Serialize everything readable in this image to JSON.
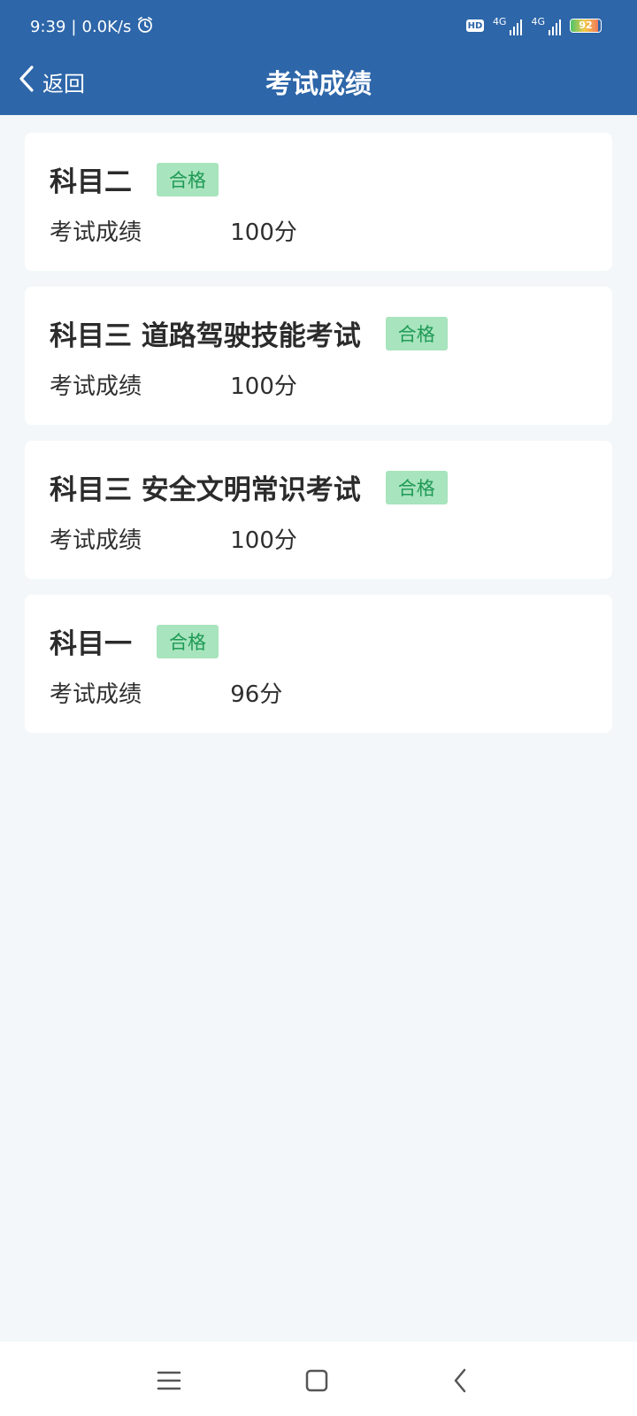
{
  "status_bar": {
    "time": "9:39",
    "speed": "0.0K/s",
    "hd": "HD",
    "network1": "4G",
    "network2": "4G",
    "battery": "92",
    "battery_fraction": 0.92
  },
  "header": {
    "back_label": "返回",
    "title": "考试成绩"
  },
  "exams": [
    {
      "subject": "科目二",
      "status": "合格",
      "score_label": "考试成绩",
      "score": "100分"
    },
    {
      "subject": "科目三 道路驾驶技能考试",
      "status": "合格",
      "score_label": "考试成绩",
      "score": "100分"
    },
    {
      "subject": "科目三 安全文明常识考试",
      "status": "合格",
      "score_label": "考试成绩",
      "score": "100分"
    },
    {
      "subject": "科目一",
      "status": "合格",
      "score_label": "考试成绩",
      "score": "96分"
    }
  ],
  "colors": {
    "header_bg": "#2d66a9",
    "page_bg": "#f3f7f9",
    "badge_bg": "#a8e4bd",
    "badge_text": "#1f9a55"
  },
  "icons": {
    "status_alarm": "alarm-clock-icon",
    "back": "chevron-left-icon",
    "nav_menu": "menu-icon",
    "nav_home": "home-square-icon",
    "nav_back": "back-triangle-icon"
  }
}
